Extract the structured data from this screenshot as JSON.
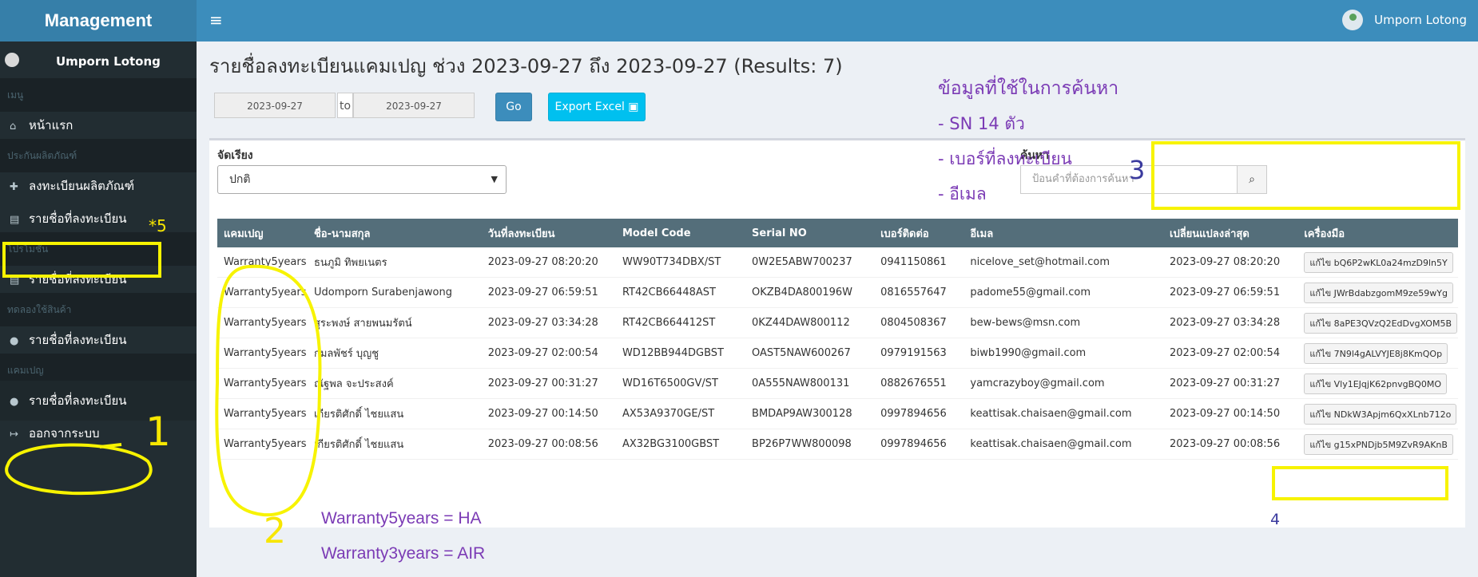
{
  "header": {
    "brand": "Management",
    "menu_glyph": "≡",
    "user_name": "Umporn Lotong"
  },
  "sidebar": {
    "user_name": "Umporn Lotong",
    "sections": [
      {
        "label": "เมนู"
      },
      {
        "label": "ประกันผลิตภัณฑ์"
      },
      {
        "label": "โปรโมชั่น"
      },
      {
        "label": "ทดลองใช้สินค้า"
      },
      {
        "label": "แคมเปญ"
      }
    ],
    "items": [
      {
        "label": "หน้าแรก",
        "icon": "home-icon"
      },
      {
        "label": "ลงทะเบียนผลิตภัณฑ์",
        "icon": "plus-icon"
      },
      {
        "label": "รายชื่อที่ลงทะเบียน",
        "icon": "file-icon"
      },
      {
        "label": "รายชื่อที่ลงทะเบียน",
        "icon": "file-icon"
      },
      {
        "label": "รายชื่อที่ลงทะเบียน",
        "icon": "user-icon"
      },
      {
        "label": "รายชื่อที่ลงทะเบียน",
        "icon": "user-icon"
      },
      {
        "label": "ออกจากระบบ",
        "icon": "sign-out-icon"
      }
    ]
  },
  "page": {
    "title": "รายชื่อลงทะเบียนแคมเปญ ช่วง 2023-09-27 ถึง 2023-09-27 (Results: 7)",
    "date_from": "2023-09-27",
    "date_to_label": "to",
    "date_to": "2023-09-27",
    "go_label": "Go",
    "export_label": "Export Excel"
  },
  "filters": {
    "sort_label": "จัดเรียง",
    "sort_value": "ปกติ",
    "search_label": "ค้นหา",
    "search_placeholder": "ป้อนคำที่ต้องการค้นหา"
  },
  "table": {
    "columns": [
      "แคมเปญ",
      "ชื่อ-นามสกุล",
      "วันที่ลงทะเบียน",
      "Model Code",
      "Serial NO",
      "เบอร์ติดต่อ",
      "อีเมล",
      "เปลี่ยนแปลงล่าสุด",
      "เครื่องมือ"
    ],
    "rows": [
      [
        "Warranty5years",
        "ธนภูมิ ทิพยเนตร",
        "2023-09-27 08:20:20",
        "WW90T734DBX/ST",
        "0W2E5ABW700237",
        "0941150861",
        "nicelove_set@hotmail.com",
        "2023-09-27 08:20:20",
        "แก้ไข bQ6P2wKL0a24mzD9ln5Y"
      ],
      [
        "Warranty5years",
        "Udomporn Surabenjawong",
        "2023-09-27 06:59:51",
        "RT42CB66448AST",
        "OKZB4DA800196W",
        "0816557647",
        "padome55@gmail.com",
        "2023-09-27 06:59:51",
        "แก้ไข JWrBdabzgomM9ze59wYg"
      ],
      [
        "Warranty5years",
        "สุระพงษ์ สายพนมรัตน์",
        "2023-09-27 03:34:28",
        "RT42CB664412ST",
        "0KZ44DAW800112",
        "0804508367",
        "bew-bews@msn.com",
        "2023-09-27 03:34:28",
        "แก้ไข 8aPE3QVzQ2EdDvgXOM5B"
      ],
      [
        "Warranty5years",
        "กมลพัชร์ บุญชู",
        "2023-09-27 02:00:54",
        "WD12BB944DGBST",
        "OAST5NAW600267",
        "0979191563",
        "biwb1990@gmail.com",
        "2023-09-27 02:00:54",
        "แก้ไข 7N9l4gALVYJE8j8KmQOp"
      ],
      [
        "Warranty5years",
        "ณัฐพล จะประสงค์",
        "2023-09-27 00:31:27",
        "WD16T6500GV/ST",
        "0A555NAW800131",
        "0882676551",
        "yamcrazyboy@gmail.com",
        "2023-09-27 00:31:27",
        "แก้ไข Vly1EJqjK62pnvgBQ0MO"
      ],
      [
        "Warranty5years",
        "เกียรติศักดิ์ ไชยแสน",
        "2023-09-27 00:14:50",
        "AX53A9370GE/ST",
        "BMDAP9AW300128",
        "0997894656",
        "keattisak.chaisaen@gmail.com",
        "2023-09-27 00:14:50",
        "แก้ไข NDkW3Apjm6QxXLnb712o"
      ],
      [
        "Warranty5years",
        "เกียรติศักดิ์ ไชยแสน",
        "2023-09-27 00:08:56",
        "AX32BG3100GBST",
        "BP26P7WW800098",
        "0997894656",
        "keattisak.chaisaen@gmail.com",
        "2023-09-27 00:08:56",
        "แก้ไข g15xPNDjb5M9ZvR9AKnB"
      ]
    ]
  },
  "annotations": {
    "search_info_title": "ข้อมูลที่ใช้ในการค้นหา",
    "search_info_1": "- SN  14 ตัว",
    "search_info_2": "- เบอร์ที่ลงทะเบียน",
    "search_info_3": "- อีเมล",
    "legend_ha": "Warranty5years = HA",
    "legend_air": "Warranty3years = AIR",
    "num_1": "1",
    "num_2": "2",
    "num_3": "3",
    "num_4": "4",
    "num_5": "*5"
  },
  "colors": {
    "topbar": "#3c8dbc",
    "sidebar": "#222d32",
    "highlight": "#f7f300",
    "annotation_purple": "#7b3bb5",
    "annotation_blue": "#3a3a9e"
  }
}
